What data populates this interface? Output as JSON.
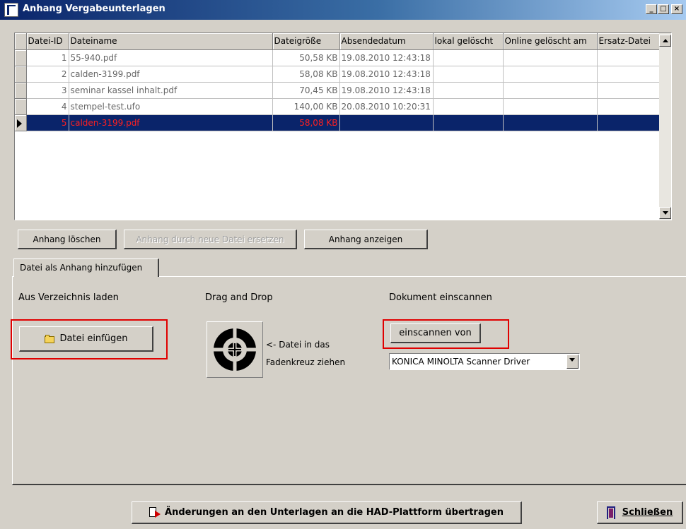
{
  "window": {
    "title": "Anhang Vergabeunterlagen",
    "controls": {
      "minimize": "_",
      "maximize": "□",
      "close": "×"
    }
  },
  "grid": {
    "columns": [
      "Datei-ID",
      "Dateiname",
      "Dateigröße",
      "Absendedatum",
      "lokal gelöscht",
      "Online gelöscht am",
      "Ersatz-Datei"
    ],
    "rows": [
      {
        "id": "1",
        "name": "55-940.pdf",
        "size": "50,58 KB",
        "date": "19.08.2010 12:43:18",
        "local_deleted": "",
        "online_deleted": "",
        "replacement": ""
      },
      {
        "id": "2",
        "name": "calden-3199.pdf",
        "size": "58,08 KB",
        "date": "19.08.2010 12:43:18",
        "local_deleted": "",
        "online_deleted": "",
        "replacement": ""
      },
      {
        "id": "3",
        "name": "seminar kassel inhalt.pdf",
        "size": "70,45 KB",
        "date": "19.08.2010 12:43:18",
        "local_deleted": "",
        "online_deleted": "",
        "replacement": ""
      },
      {
        "id": "4",
        "name": "stempel-test.ufo",
        "size": "140,00 KB",
        "date": "20.08.2010 10:20:31",
        "local_deleted": "",
        "online_deleted": "",
        "replacement": ""
      },
      {
        "id": "5",
        "name": "calden-3199.pdf",
        "size": "58,08 KB",
        "date": "",
        "local_deleted": "",
        "online_deleted": "",
        "replacement": "",
        "selected": true
      }
    ]
  },
  "actions": {
    "delete": "Anhang löschen",
    "replace": "Anhang durch neue Datei ersetzen",
    "show": "Anhang anzeigen"
  },
  "tab": {
    "label": "Datei als Anhang hinzufügen"
  },
  "sections": {
    "directory": {
      "heading": "Aus Verzeichnis laden",
      "button": "Datei einfügen"
    },
    "dragdrop": {
      "heading": "Drag and Drop",
      "hint_line1": "<- Datei in das",
      "hint_line2": "Fadenkreuz ziehen"
    },
    "scan": {
      "heading": "Dokument einscannen",
      "button": "einscannen von",
      "scanner": "KONICA MINOLTA Scanner Driver"
    }
  },
  "footer": {
    "transfer": "Änderungen an den Unterlagen an die HAD-Plattform übertragen",
    "close": "Schließen"
  },
  "colors": {
    "highlight": "#e00000",
    "selection": "#0a246a",
    "selected_text": "#ff2020"
  }
}
